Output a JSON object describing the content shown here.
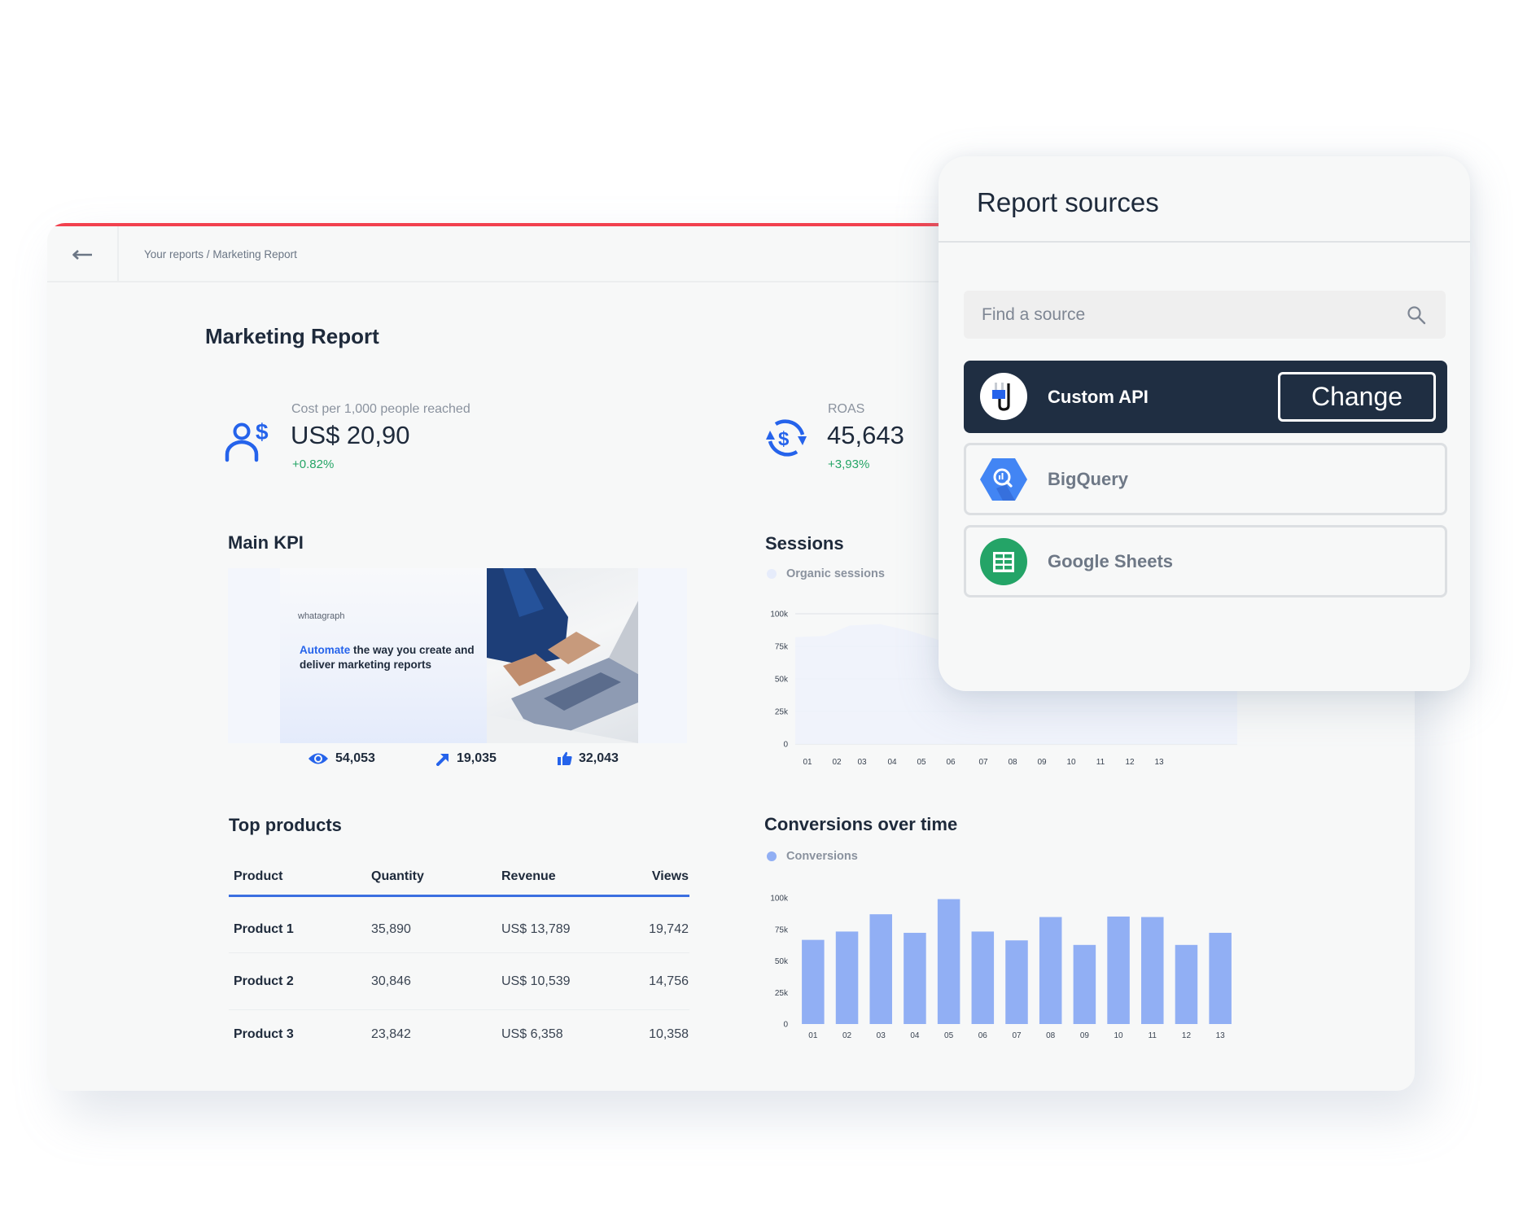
{
  "header": {
    "back_icon": "arrow-left-icon",
    "breadcrumb": [
      "Your reports",
      "Marketing Report"
    ],
    "breadcrumb_separator": " / "
  },
  "report": {
    "title": "Marketing Report",
    "kpis": [
      {
        "label": "Cost per 1,000 people reached",
        "value": "US$ 20,90",
        "change": "+0.82%",
        "icon": "user-dollar-icon"
      },
      {
        "label": "ROAS",
        "value": "45,643",
        "change": "+3,93%",
        "icon": "dollar-cycle-icon"
      }
    ],
    "main_kpi": {
      "title": "Main KPI",
      "banner": {
        "brand": "whatagraph",
        "tagline_accent": "Automate",
        "tagline_rest": " the way you create and deliver marketing reports"
      },
      "stats": [
        {
          "icon": "eye-icon",
          "value": "54,053"
        },
        {
          "icon": "arrow-up-right-icon",
          "value": "19,035"
        },
        {
          "icon": "thumbs-up-icon",
          "value": "32,043"
        }
      ]
    },
    "top_products": {
      "title": "Top products",
      "columns": [
        "Product",
        "Quantity",
        "Revenue",
        "Views"
      ],
      "rows": [
        [
          "Product 1",
          "35,890",
          "US$ 13,789",
          "19,742"
        ],
        [
          "Product 2",
          "30,846",
          "US$ 10,539",
          "14,756"
        ],
        [
          "Product 3",
          "23,842",
          "US$ 6,358",
          "10,358"
        ]
      ]
    }
  },
  "colors": {
    "accent_red": "#f2414e",
    "brand_blue": "#2563eb",
    "positive_green": "#25a566",
    "bar_blue": "#91aff4",
    "area_blue": "#eef2fb",
    "dark_navy": "#1f2e42"
  },
  "chart_data": [
    {
      "type": "area",
      "title": "Sessions",
      "legend": [
        "Organic sessions"
      ],
      "categories": [
        "01",
        "02",
        "03",
        "04",
        "05",
        "06",
        "07",
        "08",
        "09",
        "10",
        "11",
        "12",
        "13"
      ],
      "series": [
        {
          "name": "Organic sessions",
          "values": [
            82,
            83,
            91,
            92,
            87,
            80,
            78,
            82,
            80,
            84,
            83,
            80,
            82
          ]
        }
      ],
      "yticks": [
        "0",
        "25k",
        "50k",
        "75k",
        "100k"
      ],
      "ylim": [
        0,
        100
      ],
      "yunit": "k",
      "grid": true,
      "legend_position": "top-left"
    },
    {
      "type": "bar",
      "title": "Conversions over time",
      "legend": [
        "Conversions"
      ],
      "categories": [
        "01",
        "02",
        "03",
        "04",
        "05",
        "06",
        "07",
        "08",
        "09",
        "10",
        "11",
        "12",
        "13"
      ],
      "series": [
        {
          "name": "Conversions",
          "values": [
            66.7,
            73.3,
            87,
            72.3,
            99,
            73.3,
            66.3,
            84.8,
            62.7,
            85.2,
            84.8,
            62.7,
            72.3
          ]
        }
      ],
      "yticks": [
        "0",
        "25k",
        "50k",
        "75k",
        "100k"
      ],
      "ylim": [
        0,
        100
      ],
      "yunit": "k",
      "grid": false,
      "legend_position": "top-left"
    }
  ],
  "sources_panel": {
    "title": "Report sources",
    "search": {
      "placeholder": "Find a source",
      "value": "",
      "icon": "search-icon"
    },
    "sources": [
      {
        "name": "Custom API",
        "icon": "plug-icon",
        "selected": true,
        "action_label": "Change"
      },
      {
        "name": "BigQuery",
        "icon": "bigquery-icon",
        "selected": false
      },
      {
        "name": "Google Sheets",
        "icon": "google-sheets-icon",
        "selected": false
      }
    ]
  }
}
